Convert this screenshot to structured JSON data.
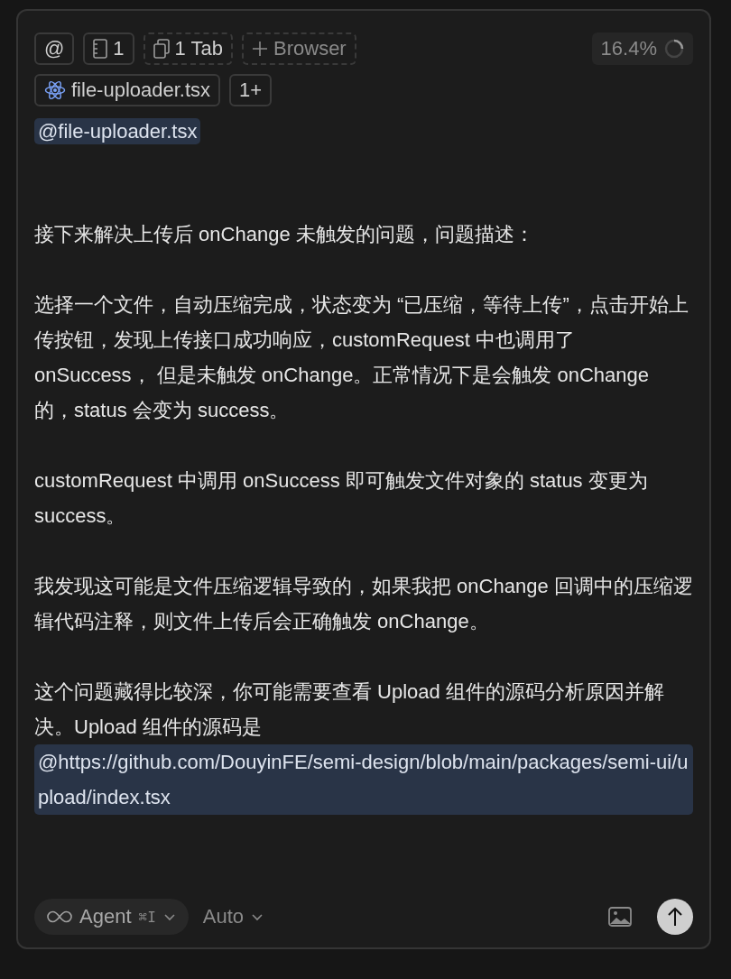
{
  "toolbar": {
    "items": [
      {
        "kind": "plain",
        "label": "@"
      },
      {
        "kind": "rules",
        "label": "1"
      },
      {
        "kind": "tabs",
        "label": "1 Tab"
      },
      {
        "kind": "add",
        "label": "Browser"
      }
    ],
    "usage": "16.4%"
  },
  "context": {
    "files": [
      {
        "label": "file-uploader.tsx"
      }
    ],
    "more": "1+"
  },
  "message": {
    "mention": "@file-uploader.tsx",
    "paragraphs": [
      "接下来解决上传后 onChange 未触发的问题，问题描述：",
      "选择一个文件，自动压缩完成，状态变为 “已压缩，等待上传”，点击开始上传按钮，发现上传接口成功响应，customRequest 中也调用了 onSuccess， 但是未触发 onChange。正常情况下是会触发 onChange 的，status 会变为 success。",
      "customRequest 中调用 onSuccess 即可触发文件对象的 status 变更为 success。",
      "我发现这可能是文件压缩逻辑导致的，如果我把 onChange 回调中的压缩逻辑代码注释，则文件上传后会正确触发 onChange。",
      "这个问题藏得比较深，你可能需要查看 Upload 组件的源码分析原因并解决。Upload 组件的源码是"
    ],
    "link": "@https://github.com/DouyinFE/semi-design/blob/main/packages/semi-ui/upload/index.tsx"
  },
  "footer": {
    "mode": "Agent",
    "shortcut": "⌘I",
    "model": "Auto"
  }
}
